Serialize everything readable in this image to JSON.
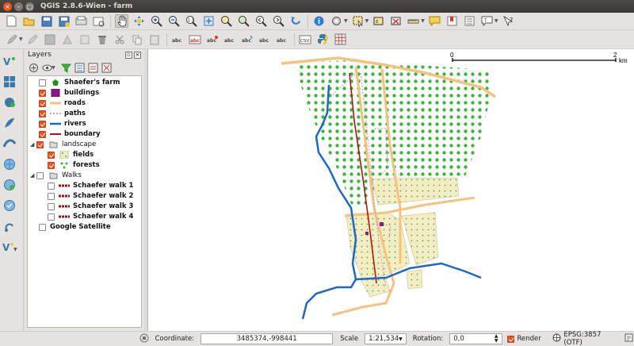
{
  "window": {
    "title": "QGIS 2.8.6-Wien - farm"
  },
  "panel": {
    "title": "Layers"
  },
  "layers": [
    {
      "label": "Shaefer's farm",
      "checked": false,
      "bold": true,
      "symbol": "pentagon"
    },
    {
      "label": "buildings",
      "checked": true,
      "bold": true,
      "symbol": "purple-fill"
    },
    {
      "label": "roads",
      "checked": true,
      "bold": true,
      "symbol": "orange-line"
    },
    {
      "label": "paths",
      "checked": true,
      "bold": true,
      "symbol": "dashed-line"
    },
    {
      "label": "rivers",
      "checked": true,
      "bold": true,
      "symbol": "blue-line"
    },
    {
      "label": "boundary",
      "checked": true,
      "bold": true,
      "symbol": "red-line"
    },
    {
      "label": "landscape",
      "checked": true,
      "bold": false,
      "symbol": "group"
    },
    {
      "label": "fields",
      "checked": true,
      "bold": true,
      "symbol": "dot-fill"
    },
    {
      "label": "forests",
      "checked": true,
      "bold": true,
      "symbol": "green-dot-fill"
    },
    {
      "label": "Walks",
      "checked": false,
      "bold": false,
      "symbol": "group"
    },
    {
      "label": "Schaefer walk 1",
      "checked": false,
      "bold": true,
      "symbol": "walk-line"
    },
    {
      "label": "Schaefer walk 2",
      "checked": false,
      "bold": true,
      "symbol": "walk-line"
    },
    {
      "label": "Schaefer walk 3",
      "checked": false,
      "bold": true,
      "symbol": "walk-line"
    },
    {
      "label": "Schaefer walk 4",
      "checked": false,
      "bold": true,
      "symbol": "walk-line"
    },
    {
      "label": "Google Satellite",
      "checked": false,
      "bold": true,
      "symbol": "none"
    }
  ],
  "scalebar": {
    "start": "0",
    "end": "2",
    "unit": "km"
  },
  "status": {
    "coordinate_label": "Coordinate:",
    "coordinate": "3485374,-998441",
    "scale_label": "Scale",
    "scale": "1:21,534",
    "rotation_label": "Rotation:",
    "rotation": "0,0",
    "render_label": "Render",
    "crs": "EPSG:3857 (OTF)"
  },
  "colors": {
    "accent": "#e95420",
    "road": "#f5c27f",
    "river": "#1f66c7",
    "boundary": "#b01515",
    "forest": "#3cb43c",
    "field": "#f3edc2"
  }
}
